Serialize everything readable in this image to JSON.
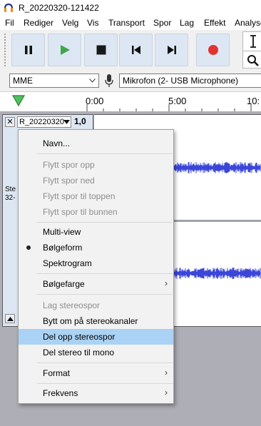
{
  "window": {
    "title": "R_20220320-121422"
  },
  "menubar": {
    "items": [
      "Fil",
      "Rediger",
      "Velg",
      "Vis",
      "Transport",
      "Spor",
      "Lag",
      "Effekt",
      "Analyser"
    ]
  },
  "toolbar": {
    "buttons": [
      "pause-icon",
      "play-icon",
      "stop-icon",
      "skip-to-start-icon",
      "skip-to-end-icon",
      "record-icon"
    ]
  },
  "device": {
    "host": "MME",
    "input": "Mikrofon (2- USB Microphone)"
  },
  "timeline": {
    "ticks": [
      "0:00",
      "5:00",
      "10:"
    ]
  },
  "track": {
    "name": "R_20220320",
    "scale": "1,0",
    "info_line1": "Ste",
    "info_line2": "32-"
  },
  "context_menu": {
    "items": [
      {
        "label": "Navn...",
        "enabled": true
      },
      {
        "label": "Flytt spor opp",
        "enabled": false
      },
      {
        "label": "Flytt spor ned",
        "enabled": false
      },
      {
        "label": "Flytt spor til toppen",
        "enabled": false
      },
      {
        "label": "Flytt spor til bunnen",
        "enabled": false
      },
      {
        "label": "Multi-view",
        "enabled": true
      },
      {
        "label": "Bølgeform",
        "enabled": true,
        "checked": true
      },
      {
        "label": "Spektrogram",
        "enabled": true
      },
      {
        "label": "Bølgefarge",
        "enabled": true,
        "submenu": true
      },
      {
        "label": "Lag stereospor",
        "enabled": false
      },
      {
        "label": "Bytt om på stereokanaler",
        "enabled": true
      },
      {
        "label": "Del opp stereospor",
        "enabled": true,
        "highlighted": true
      },
      {
        "label": "Del stereo til mono",
        "enabled": true
      },
      {
        "label": "Format",
        "enabled": true,
        "submenu": true
      },
      {
        "label": "Frekvens",
        "enabled": true,
        "submenu": true
      }
    ]
  },
  "colors": {
    "accent_play": "#3fa64a",
    "record": "#e33232",
    "waveform": "#3b46d9",
    "highlight": "#aad2f4"
  }
}
